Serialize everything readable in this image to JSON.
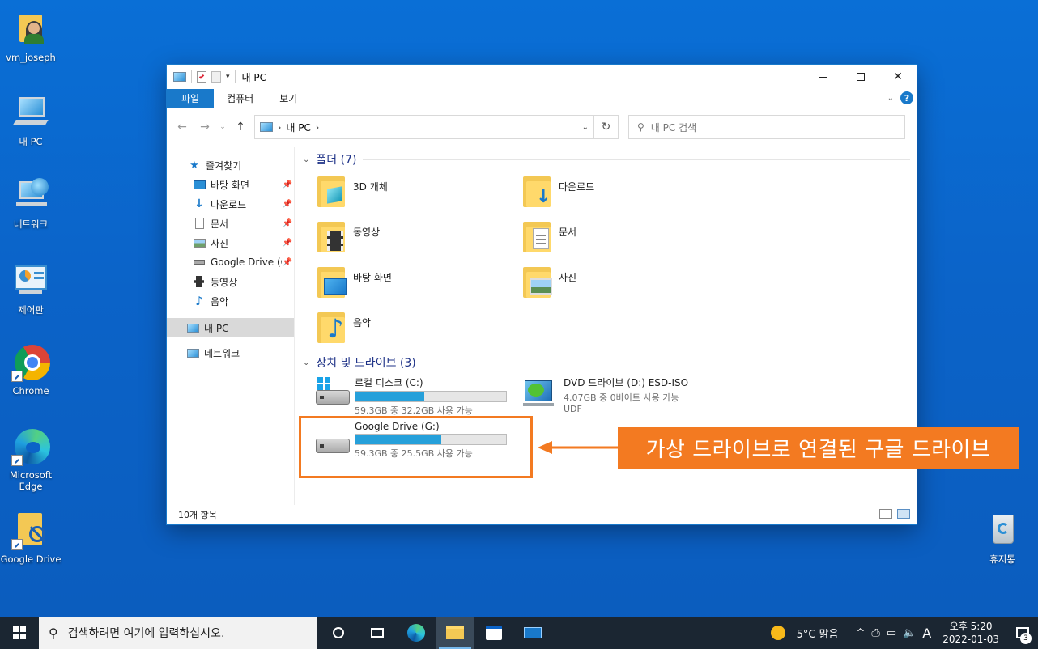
{
  "desktop": {
    "icons": [
      {
        "label": "vm_joseph"
      },
      {
        "label": "내 PC"
      },
      {
        "label": "네트워크"
      },
      {
        "label": "제어판"
      },
      {
        "label": "Chrome"
      },
      {
        "label": "Microsoft Edge"
      },
      {
        "label": "Google Drive"
      },
      {
        "label": "휴지통"
      }
    ]
  },
  "window": {
    "title": "내 PC",
    "ribbon_tabs": [
      "파일",
      "컴퓨터",
      "보기"
    ],
    "address": {
      "location": "내 PC"
    },
    "search_placeholder": "내 PC 검색",
    "nav": {
      "quick_access": "즐겨찾기",
      "items": [
        {
          "label": "바탕 화면",
          "pinned": true
        },
        {
          "label": "다운로드",
          "pinned": true
        },
        {
          "label": "문서",
          "pinned": true
        },
        {
          "label": "사진",
          "pinned": true
        },
        {
          "label": "Google Drive (G",
          "pinned": true
        },
        {
          "label": "동영상",
          "pinned": false
        },
        {
          "label": "음악",
          "pinned": false
        }
      ],
      "this_pc": "내 PC",
      "network": "네트워크"
    },
    "folders_group": "폴더 (7)",
    "folders": [
      {
        "name": "3D 개체"
      },
      {
        "name": "다운로드"
      },
      {
        "name": "동영상"
      },
      {
        "name": "문서"
      },
      {
        "name": "바탕 화면"
      },
      {
        "name": "사진"
      },
      {
        "name": "음악"
      }
    ],
    "drives_group": "장치 및 드라이브 (3)",
    "drives": [
      {
        "name": "로컬 디스크 (C:)",
        "free_text": "59.3GB 중 32.2GB 사용 가능",
        "used_fraction": 0.457
      },
      {
        "name": "DVD 드라이브 (D:) ESD-ISO",
        "free_text": "4.07GB 중 0바이트 사용 가능",
        "fs": "UDF"
      },
      {
        "name": "Google Drive (G:)",
        "free_text": "59.3GB 중 25.5GB 사용 가능",
        "used_fraction": 0.57
      }
    ],
    "status": "10개 항목"
  },
  "annotation": {
    "callout_text": "가상 드라이브로 연결된 구글 드라이브",
    "color": "#f37a21"
  },
  "taskbar": {
    "search_placeholder": "검색하려면 여기에 입력하십시오.",
    "weather": "5°C  맑음",
    "ime": "A",
    "time": "오후 5:20",
    "date": "2022-01-03",
    "notification_count": "3"
  }
}
